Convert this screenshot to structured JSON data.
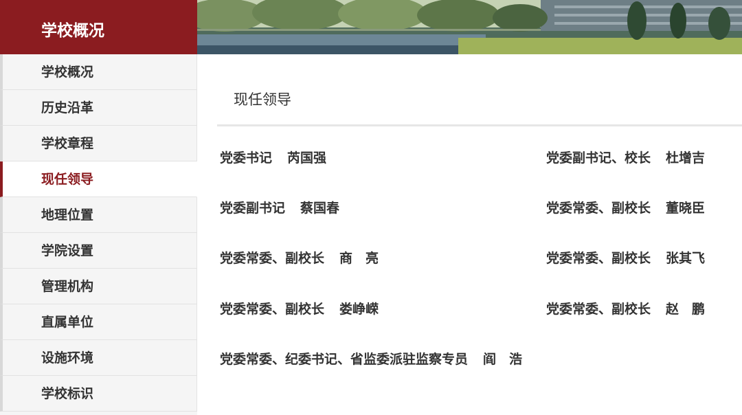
{
  "sidebar": {
    "title": "学校概况",
    "items": [
      {
        "label": "学校概况"
      },
      {
        "label": "历史沿革"
      },
      {
        "label": "学校章程"
      },
      {
        "label": "现任领导",
        "active": true
      },
      {
        "label": "地理位置"
      },
      {
        "label": "学院设置"
      },
      {
        "label": "管理机构"
      },
      {
        "label": "直属单位"
      },
      {
        "label": "设施环境"
      },
      {
        "label": "学校标识"
      }
    ]
  },
  "main": {
    "page_title": "现任领导",
    "leaders": [
      {
        "title": "党委书记",
        "name": "芮国强"
      },
      {
        "title": "党委副书记、校长",
        "name": "杜增吉"
      },
      {
        "title": "党委副书记",
        "name": "蔡国春"
      },
      {
        "title": "党委常委、副校长",
        "name": "董晓臣"
      },
      {
        "title": "党委常委、副校长",
        "name": "商　亮"
      },
      {
        "title": "党委常委、副校长",
        "name": "张其飞"
      },
      {
        "title": "党委常委、副校长",
        "name": "娄峥嵘"
      },
      {
        "title": "党委常委、副校长",
        "name": "赵　鹏"
      },
      {
        "title": "党委常委、纪委书记、省监委派驻监察专员",
        "name": "阎　浩"
      }
    ]
  },
  "colors": {
    "brand": "#8b1c20",
    "sidebar_bg": "#f5f5f5",
    "text": "#333333"
  }
}
